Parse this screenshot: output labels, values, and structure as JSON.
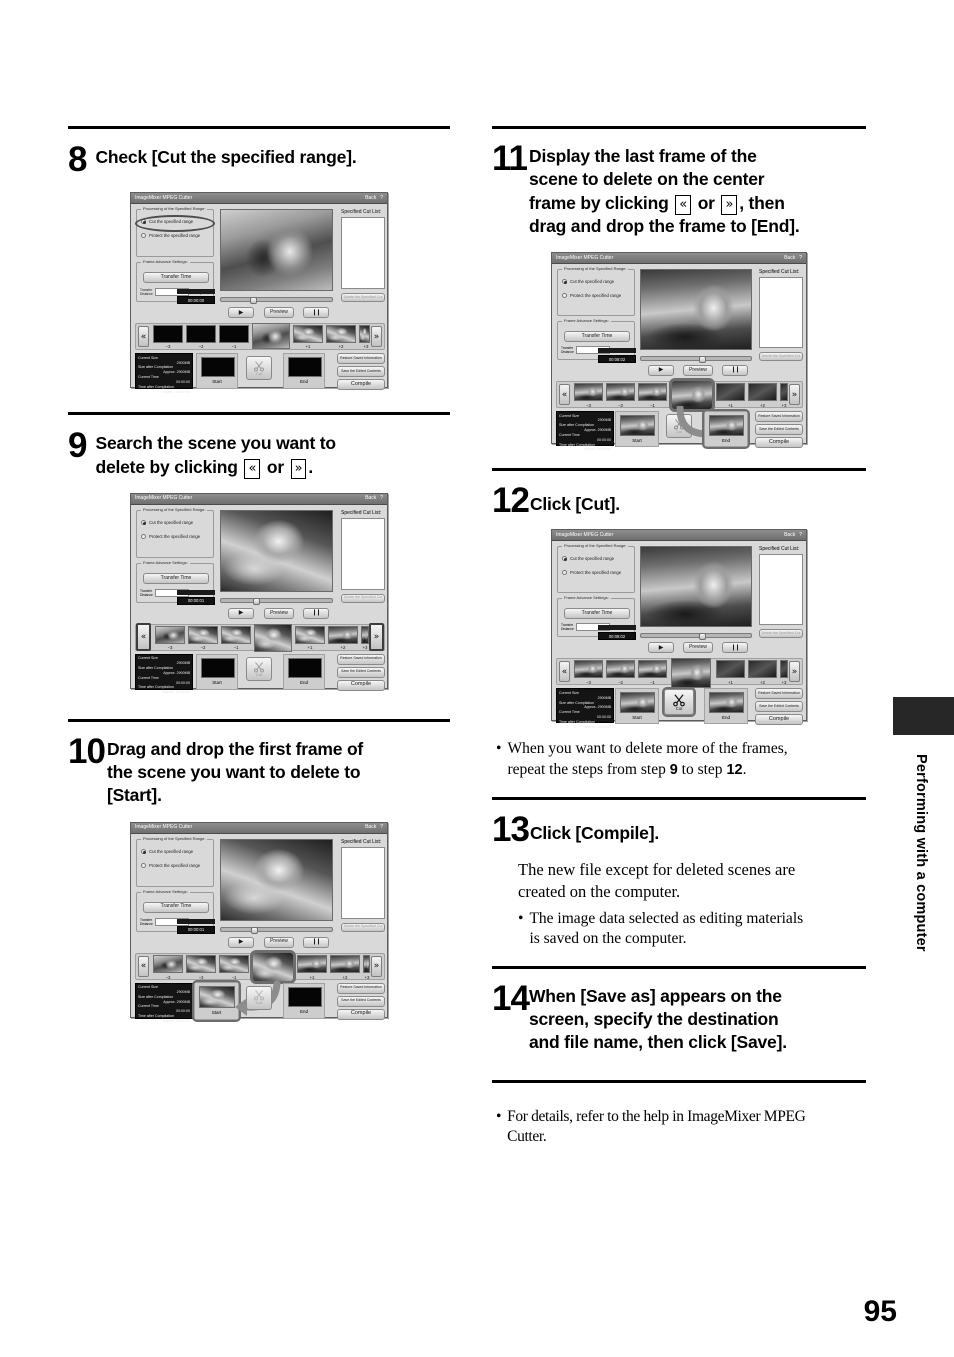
{
  "page": {
    "number": "95",
    "side_tab_label": "Performing with a computer"
  },
  "steps": {
    "s8": {
      "num": "8",
      "text": "Check [Cut the specified range]."
    },
    "s9": {
      "num": "9",
      "text_a": "Search the scene you want to",
      "text_b": "delete by clicking",
      "key_prev": "«",
      "or": "or",
      "key_next": "»",
      "text_c": "."
    },
    "s10": {
      "num": "10",
      "line1": "Drag and drop the first frame of",
      "line2": "the scene you want to delete to",
      "line3": "[Start]."
    },
    "s11": {
      "num": "11",
      "line1": "Display the last frame of the",
      "line2": "scene to delete on the center",
      "line3_a": "frame by clicking",
      "key_prev": "«",
      "or": "or",
      "key_next": "»",
      "line3_b": ", then",
      "line4": "drag and drop the frame to [End]."
    },
    "s12": {
      "num": "12",
      "text": "Click [Cut].",
      "note_dot": "•",
      "note_a": "When you want to delete more of the frames,",
      "note_b1": "repeat the steps from step",
      "note_b_num1": "9",
      "note_b2": "to step",
      "note_b_num2": "12",
      "note_b3": "."
    },
    "s13": {
      "num": "13",
      "text": "Click [Compile].",
      "body1": "The new file except for deleted scenes are",
      "body2": "created on the computer.",
      "note_dot": "•",
      "note1": "The image data selected as editing materials",
      "note2": "is saved on the computer."
    },
    "s14": {
      "num": "14",
      "line1": "When [Save as] appears on the",
      "line2": "screen, specify the destination",
      "line3": "and file name, then click [Save]."
    },
    "footer_note": {
      "dot": "•",
      "line1": "For details, refer to the help in ImageMixer MPEG",
      "line2": "Cutter."
    }
  },
  "app": {
    "title": "ImageMixer MPEG Cutter",
    "back_label": "Back",
    "help_label": "?",
    "group_range_label": "Processing of the Specified Range:",
    "radio_cut": "Cut the specified range",
    "radio_protect": "Protect the specified range",
    "group_frame_label": "Frame Advance Settings:",
    "btn_transfer_time": "Transfer Time",
    "transfer_distance_label": "Transfer\nDistance",
    "transfer_distance_value": "1",
    "transfer_unit": "Group",
    "cut_list_label": "Specified Cut List:",
    "btn_delete_cut": "Delete the Specified Cut",
    "btn_preview": "Preview",
    "btn_play": "▶",
    "btn_pause": "❙❙",
    "nav_prev": "«",
    "nav_next": "»",
    "frame_labels": [
      "−3",
      "−2",
      "−1",
      "+1",
      "+2",
      "+3"
    ],
    "btn_start": "Start",
    "btn_end": "End",
    "btn_cut": "Cut",
    "btn_restore": "Restore Saved Information",
    "btn_save_edited": "Save the Edited Contents",
    "btn_compile": "Compile",
    "stats": {
      "current_size_label": "Current Size",
      "current_size_value": "2900MB",
      "size_after_label": "Size after Compilation",
      "size_after_value": "Approx. 2900MB",
      "current_time_label": "Current Time",
      "current_time_value": "00:00:00",
      "time_after_label": "Time after Compilation",
      "time_after_value": "Approx. 00:00:00"
    },
    "timecodes": {
      "shot8": "00:00:00",
      "shot9": "00:00:01",
      "shot10": "00:00:01",
      "shot11": "00:08:02",
      "shot12": "00:08:02"
    }
  }
}
